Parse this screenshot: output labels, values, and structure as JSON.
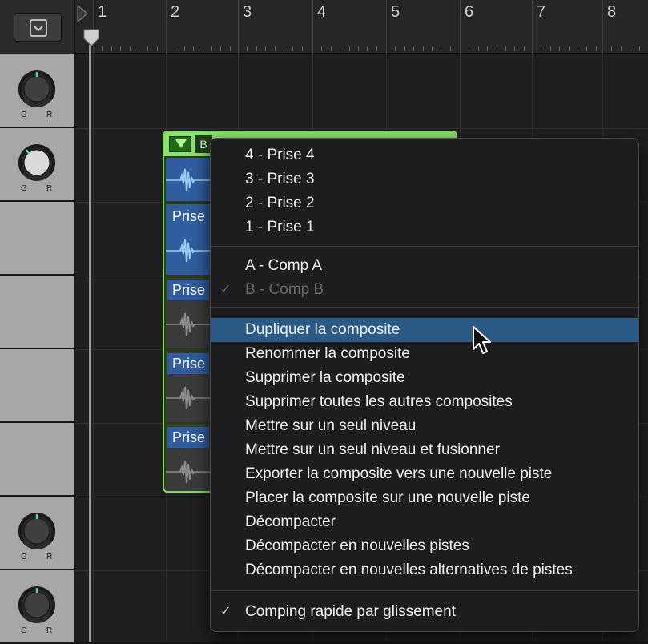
{
  "ruler": {
    "bars": [
      "1",
      "2",
      "3",
      "4",
      "5",
      "6",
      "7",
      "8"
    ]
  },
  "tracks": [
    {
      "knob_left": "G",
      "knob_right": "R"
    },
    {
      "knob_left": "G",
      "knob_right": "R"
    },
    {
      "knob_left": "G",
      "knob_right": "R"
    },
    {
      "knob_left": "G",
      "knob_right": "R"
    }
  ],
  "comp_region": {
    "header_label": "B",
    "take_labels": [
      "Prise",
      "Prise",
      "Prise",
      "Prise"
    ]
  },
  "context_menu": {
    "takes": [
      "4 - Prise 4",
      "3 - Prise 3",
      "2 - Prise 2",
      "1 - Prise 1"
    ],
    "comps": [
      {
        "label": "A - Comp A",
        "checked": false,
        "enabled": true
      },
      {
        "label": "B - Comp B",
        "checked": true,
        "enabled": false
      }
    ],
    "actions": [
      "Dupliquer la composite",
      "Renommer la composite",
      "Supprimer la composite",
      "Supprimer toutes les autres composites",
      "Mettre sur un seul niveau",
      "Mettre sur un seul niveau et fusionner",
      "Exporter la composite vers une nouvelle piste",
      "Placer la composite sur une nouvelle piste",
      "Décompacter",
      "Décompacter en nouvelles pistes",
      "Décompacter en nouvelles alternatives de pistes"
    ],
    "highlighted_action": "Dupliquer la composite",
    "quick_swipe": {
      "label": "Comping rapide par glissement",
      "checked": true
    },
    "check_glyph": "✓"
  },
  "colors": {
    "comp_green": "#7be05b",
    "take_blue": "#2f5d9e",
    "menu_highlight": "#2b5a86"
  }
}
